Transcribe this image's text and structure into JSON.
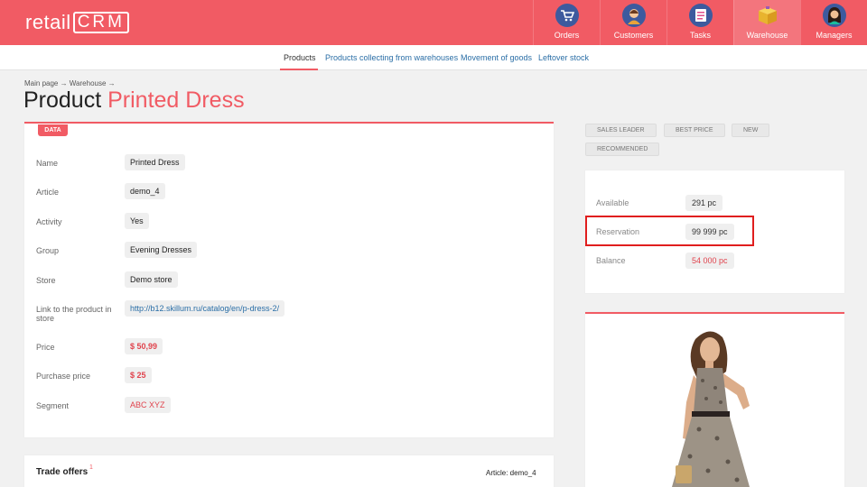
{
  "header": {
    "logo_text": "retail",
    "logo_crm": "CRM",
    "nav": [
      {
        "label": "Orders",
        "icon": "cart-icon"
      },
      {
        "label": "Customers",
        "icon": "customer-avatar-icon"
      },
      {
        "label": "Tasks",
        "icon": "task-list-icon"
      },
      {
        "label": "Warehouse",
        "icon": "box-icon",
        "active": true
      },
      {
        "label": "Managers",
        "icon": "manager-avatar-icon"
      }
    ]
  },
  "subnav": {
    "items": [
      {
        "label": "Products",
        "active": true
      },
      {
        "label": "Products collecting from warehouses"
      },
      {
        "label": "Movement of goods"
      },
      {
        "label": "Leftover stock"
      }
    ]
  },
  "breadcrumb": "Main page → Warehouse →",
  "page": {
    "title_prefix": "Product",
    "title_name": "Printed Dress"
  },
  "data_card": {
    "tag": "DATA",
    "fields": [
      {
        "label": "Name",
        "value": "Printed Dress"
      },
      {
        "label": "Article",
        "value": "demo_4"
      },
      {
        "label": "Activity",
        "value": "Yes"
      },
      {
        "label": "Group",
        "value": "Evening Dresses"
      },
      {
        "label": "Store",
        "value": "Demo store"
      },
      {
        "label": "Link to the product in store",
        "value": "http://b12.skillum.ru/catalog/en/p-dress-2/"
      },
      {
        "label": "Price",
        "value": "$ 50,99"
      },
      {
        "label": "Purchase price",
        "value": "$ 25"
      },
      {
        "label": "Segment",
        "value": "ABC XYZ"
      }
    ]
  },
  "tags": [
    "SALES LEADER",
    "BEST PRICE",
    "NEW",
    "RECOMMENDED"
  ],
  "stock": {
    "available_label": "Available",
    "available_value": "291 pc",
    "reservation_label": "Reservation",
    "reservation_value": "99 999 pc",
    "balance_label": "Balance",
    "balance_value": "54 000 pc"
  },
  "trade_offers": {
    "title": "Trade offers",
    "count": "1",
    "article": "Article: demo_4"
  },
  "colors": {
    "brand": "#f15b64",
    "link": "#2a6ea6",
    "highlight": "#e01e1e"
  }
}
